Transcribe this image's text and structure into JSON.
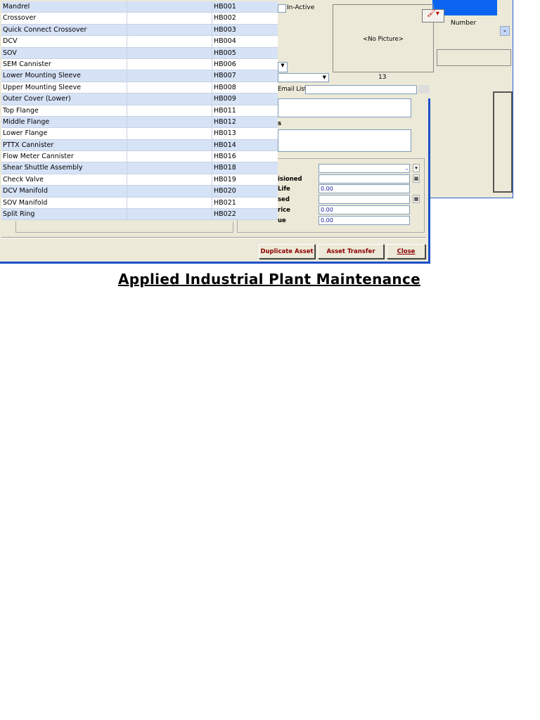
{
  "assets": [
    {
      "name": "Mandrel",
      "code": "HB001"
    },
    {
      "name": "Crossover",
      "code": "HB002"
    },
    {
      "name": "Quick Connect Crossover",
      "code": "HB003"
    },
    {
      "name": "DCV",
      "code": "HB004"
    },
    {
      "name": "SOV",
      "code": "HB005"
    },
    {
      "name": "SEM Cannister",
      "code": "HB006"
    },
    {
      "name": "Lower Mounting Sleeve",
      "code": "HB007"
    },
    {
      "name": "Upper Mounting Sleeve",
      "code": "HB008"
    },
    {
      "name": "Outer Cover (Lower)",
      "code": "HB009"
    },
    {
      "name": "Top Flange",
      "code": "HB011"
    },
    {
      "name": "Middle Flange",
      "code": "HB012"
    },
    {
      "name": "Lower Flange",
      "code": "HB013"
    },
    {
      "name": "PTTX Cannister",
      "code": "HB014"
    },
    {
      "name": "Flow Meter Cannister",
      "code": "HB016"
    },
    {
      "name": "Shear Shuttle Assembly",
      "code": "HB018"
    },
    {
      "name": "Check Valve",
      "code": "HB019"
    },
    {
      "name": "DCV Manifold",
      "code": "HB020"
    },
    {
      "name": "SOV Manifold",
      "code": "HB021"
    },
    {
      "name": "Split Ring",
      "code": "HB022"
    }
  ],
  "form": {
    "inactive": "In-Active",
    "no_picture": "<No Picture>",
    "picture_count": "13",
    "email_list": "Email List",
    "notes_label_fragment": "s",
    "commissioned": "isioned",
    "life": "Life",
    "life_value": "0.00",
    "used": "sed",
    "price": "rice",
    "price_value": "0.00",
    "value": "ue",
    "value_value": "0.00"
  },
  "bg_window": {
    "column": "Number"
  },
  "buttons": {
    "duplicate": "Duplicate Asset",
    "transfer": "Asset Transfer",
    "close": "Close"
  },
  "page_title": "Applied Industrial Plant Maintenance"
}
